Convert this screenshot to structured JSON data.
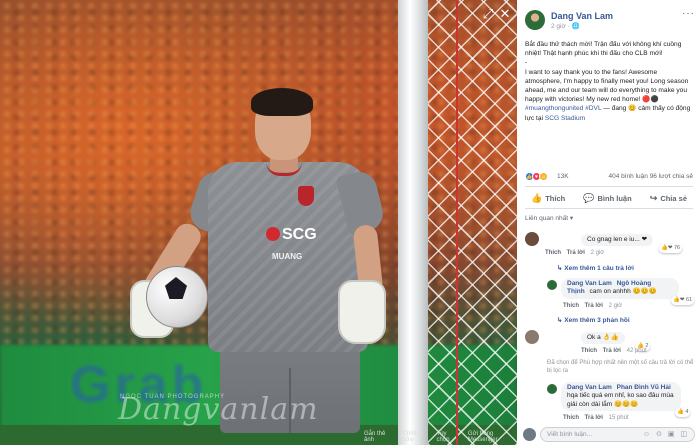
{
  "photo": {
    "sponsor": "SCG",
    "shirt_sub": "MUANG",
    "ad_board_text": "Grab",
    "watermark_signature": "Dangvanlam",
    "watermark_sub": "NGOC TUAN PHOTOGRAPHY",
    "bar": {
      "comment": "Gắn thẻ ảnh",
      "edit": "Chỉnh sửa",
      "options": "Tùy chọn",
      "messenger": "Gửi trong Messenger"
    }
  },
  "post": {
    "author": "Dang Van Lam",
    "time": "2 giờ ·",
    "more": "···",
    "body_vi": "Bắt đầu thử thách mới! Trận đấu với không khí cuồng nhiệt! Thật hạnh phúc khi thi đấu cho CLB mới!",
    "body_dash": "-",
    "body_en": "I want to say thank you to the fans! Awesome atmosphere, I'm happy to finally meet you! Long season ahead, me and our team will do everything to make you happy with victories! My new red home!",
    "hashtags": "#muangthongunited #DVL",
    "feeling": "— đang 😊 cảm thấy có động lực tại",
    "place": "SCG Stadium",
    "reaction_count": "13K",
    "comments_count": "404 bình luận",
    "shares_count": "96 lượt chia sẻ",
    "actions": {
      "like": "Thích",
      "comment": "Bình luận",
      "share": "Chia sẻ"
    },
    "sort": "Liên quan nhất ▾"
  },
  "comments": {
    "c1": {
      "text": "Co gnag len e iu... ❤",
      "like": "Thích",
      "reply": "Trả lời",
      "time": "2 giờ",
      "react": "76"
    },
    "c1_more": "Xem thêm 1 câu trả lời",
    "r1": {
      "name": "Dang Van Lam",
      "tag": "Ngô Hoàng Thịnh",
      "text": "cam on anhhh 😊😊😊",
      "like": "Thích",
      "reply": "Trả lời",
      "time": "2 giờ",
      "react": "61"
    },
    "r1_more": "Xem thêm 3 phản hồi",
    "c2": {
      "text": "Ok a 👌👍",
      "like": "Thích",
      "reply": "Trả lời",
      "time": "42 phút",
      "react": "2"
    },
    "c2_note": "Đã chọn để Phù hợp nhất nên một số câu trả lời có thể bị lọc ra",
    "r2": {
      "name": "Dang Van Lam",
      "tag": "Phan Đình Vũ Hải",
      "text": "hqa tiếc quá em nhỉ, ko sao đâu mùa giải còn dài lắm 😊😊😊",
      "like": "Thích",
      "reply": "Trả lời",
      "time": "15 phút",
      "react": "4"
    },
    "write_placeholder": "Viết bình luận...",
    "write_tools": "☺ ⊙ ▣ ◫"
  },
  "colors": {
    "link": "#385898",
    "accent_red": "#b8262c",
    "pitch_green": "#27a24a"
  }
}
